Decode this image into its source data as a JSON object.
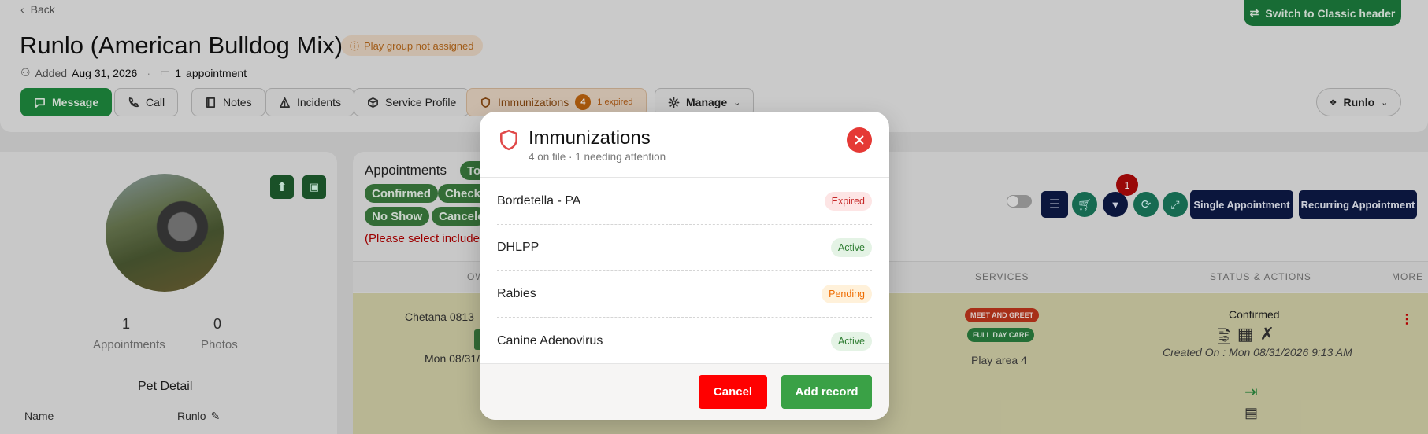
{
  "header": {
    "back_label": "Back",
    "pet_title": "Runlo (American Bulldog Mix)",
    "playgroup_badge": "Play group not assigned",
    "added_label": "Added",
    "added_date": "Aug 31, 2026",
    "appt_count": "1",
    "appt_label": "appointment",
    "switch_header": "Switch to Classic header",
    "user_menu": "Runlo"
  },
  "actions": {
    "message": "Message",
    "call": "Call",
    "notes": "Notes",
    "incidents": "Incidents",
    "service_profile": "Service Profile",
    "immunizations": "Immunizations",
    "imm_count": "4",
    "imm_expired": "1 expired",
    "manage": "Manage"
  },
  "profile": {
    "appointments_count": "1",
    "appointments_label": "Appointments",
    "photos_count": "0",
    "photos_label": "Photos",
    "pet_detail_title": "Pet Detail",
    "name_label": "Name",
    "name_value": "Runlo"
  },
  "appointments": {
    "title": "Appointments",
    "filter_today": "To",
    "filter_confirmed": "Confirmed",
    "filter_checked": "Checke",
    "filter_noshow": "No Show",
    "filter_canceled": "Cancele",
    "warning": "(Please select include",
    "filter_badge_count": "1",
    "single_btn": "Single Appointment",
    "recurring_btn": "Recurring Appointment",
    "columns": {
      "owner": "OW",
      "services": "SERVICES",
      "status": "STATUS & ACTIONS",
      "more": "MORE"
    },
    "row": {
      "owner": "Chetana 0813",
      "date": "Mon 08/31/",
      "service_tag_1": "MEET AND GREET",
      "service_tag_2": "FULL DAY CARE",
      "area": "Play area 4",
      "status": "Confirmed",
      "created": "Created On : Mon 08/31/2026 9:13 AM"
    }
  },
  "modal": {
    "title": "Immunizations",
    "subtitle": "4 on file · 1 needing attention",
    "records": [
      {
        "name": "Bordetella - PA",
        "status": "Expired"
      },
      {
        "name": "DHLPP",
        "status": "Active"
      },
      {
        "name": "Rabies",
        "status": "Pending"
      },
      {
        "name": "Canine Adenovirus",
        "status": "Active"
      }
    ],
    "cancel": "Cancel",
    "add": "Add record"
  },
  "colors": {
    "brand_green": "#1e9e4a",
    "danger_red": "#e53935",
    "navy": "#0d1a47",
    "expired_text": "#c62828",
    "active_text": "#2e7d32",
    "pending_text": "#ef6c00"
  }
}
